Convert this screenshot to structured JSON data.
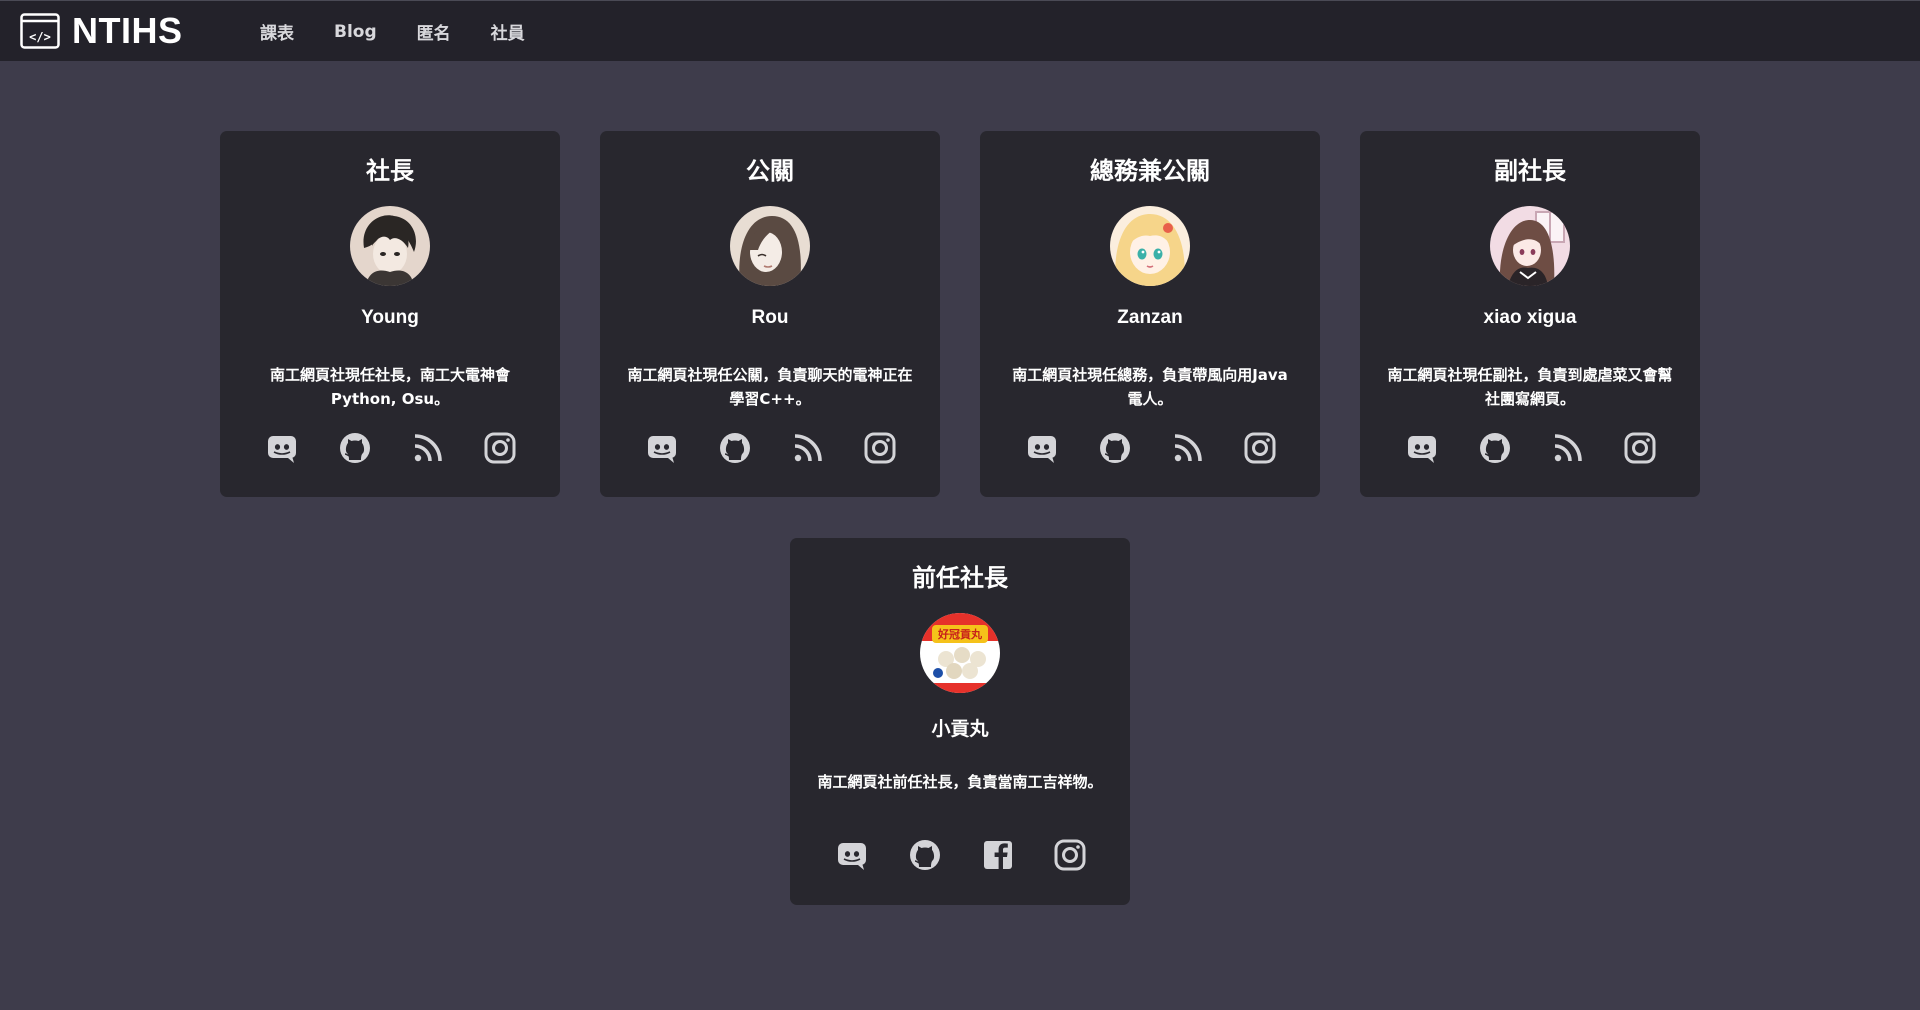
{
  "brand": {
    "name": "NTIHS",
    "logo_icon": "code-window-icon"
  },
  "nav": {
    "items": [
      {
        "label": "課表"
      },
      {
        "label": "Blog"
      },
      {
        "label": "匿名"
      },
      {
        "label": "社員"
      }
    ]
  },
  "members": [
    {
      "role": "社長",
      "name": "Young",
      "description": "南工網頁社現任社長，南工大電神會Python, Osu。",
      "socials": [
        "discord-icon",
        "github-icon",
        "rss-icon",
        "instagram-icon"
      ]
    },
    {
      "role": "公關",
      "name": "Rou",
      "description": "南工網頁社現任公關，負責聊天的電神正在學習C++。",
      "socials": [
        "discord-icon",
        "github-icon",
        "rss-icon",
        "instagram-icon"
      ]
    },
    {
      "role": "總務兼公關",
      "name": "Zanzan",
      "description": "南工網頁社現任總務，負責帶風向用Java電人。",
      "socials": [
        "discord-icon",
        "github-icon",
        "rss-icon",
        "instagram-icon"
      ]
    },
    {
      "role": "副社長",
      "name": "xiao xigua",
      "description": "南工網頁社現任副社，負責到處虐菜又會幫社團寫網頁。",
      "socials": [
        "discord-icon",
        "github-icon",
        "rss-icon",
        "instagram-icon"
      ]
    },
    {
      "role": "前任社長",
      "name": "小貢丸",
      "description": "南工網頁社前任社長，負責當南工吉祥物。",
      "socials": [
        "discord-icon",
        "github-icon",
        "facebook-icon",
        "instagram-icon"
      ],
      "avatar_label": "好冠貢丸"
    }
  ],
  "colors": {
    "page_bg": "#3e3c4b",
    "topbar_bg": "#23222a",
    "card_bg": "#28272e",
    "icon": "#d4d4d8"
  }
}
